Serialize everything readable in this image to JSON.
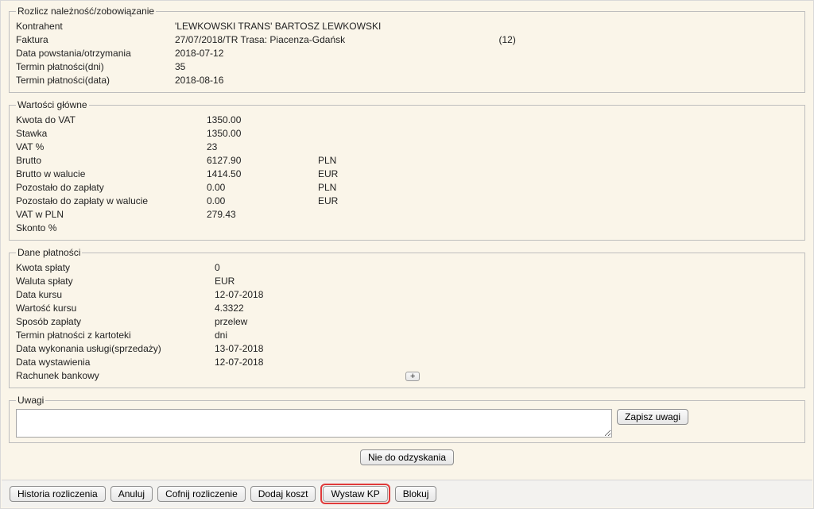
{
  "rozlicz": {
    "legend": "Rozlicz należność/zobowiązanie",
    "kontrahent_label": "Kontrahent",
    "kontrahent_value": "'LEWKOWSKI TRANS' BARTOSZ LEWKOWSKI",
    "faktura_label": "Faktura",
    "faktura_value": "27/07/2018/TR  Trasa: Piacenza-Gdańsk",
    "faktura_extra": "(12)",
    "data_pow_label": "Data powstania/otrzymania",
    "data_pow_value": "2018-07-12",
    "termin_dni_label": "Termin płatności(dni)",
    "termin_dni_value": "35",
    "termin_data_label": "Termin płatności(data)",
    "termin_data_value": "2018-08-16"
  },
  "wartosci": {
    "legend": "Wartości główne",
    "kwota_vat_label": "Kwota do VAT",
    "kwota_vat_value": "1350.00",
    "stawka_label": "Stawka",
    "stawka_value": "1350.00",
    "vatp_label": "VAT %",
    "vatp_value": "23",
    "brutto_label": "Brutto",
    "brutto_value": "6127.90",
    "brutto_cur": "PLN",
    "brutto_wal_label": "Brutto w walucie",
    "brutto_wal_value": "1414.50",
    "brutto_wal_cur": "EUR",
    "poz_zap_label": "Pozostało do zapłaty",
    "poz_zap_value": "0.00",
    "poz_zap_cur": "PLN",
    "poz_zap_wal_label": "Pozostało do zapłaty w walucie",
    "poz_zap_wal_value": "0.00",
    "poz_zap_wal_cur": "EUR",
    "vat_pln_label": "VAT w PLN",
    "vat_pln_value": "279.43",
    "skonto_label": "Skonto %",
    "skonto_value": ""
  },
  "dane": {
    "legend": "Dane płatności",
    "kwota_splaty_label": "Kwota spłaty",
    "kwota_splaty_value": "0",
    "waluta_splaty_label": "Waluta spłaty",
    "waluta_splaty_value": "EUR",
    "data_kursu_label": "Data kursu",
    "data_kursu_value": "12-07-2018",
    "wart_kursu_label": "Wartość kursu",
    "wart_kursu_value": "4.3322",
    "sposob_label": "Sposób zapłaty",
    "sposob_value": "przelew",
    "termin_kart_label": "Termin płatności z kartoteki",
    "termin_kart_value": "dni",
    "data_wyk_label": "Data wykonania usługi(sprzedaży)",
    "data_wyk_value": "13-07-2018",
    "data_wyst_label": "Data wystawienia",
    "data_wyst_value": "12-07-2018",
    "rachunek_label": "Rachunek bankowy",
    "plus": "+"
  },
  "uwagi": {
    "legend": "Uwagi",
    "text": "",
    "zapisz": "Zapisz uwagi"
  },
  "actions": {
    "nie_do_odzyskania": "Nie do odzyskania",
    "historia": "Historia rozliczenia",
    "anuluj": "Anuluj",
    "cofnij": "Cofnij rozliczenie",
    "dodaj_koszt": "Dodaj koszt",
    "wystaw_kp": "Wystaw KP",
    "blokuj": "Blokuj"
  }
}
